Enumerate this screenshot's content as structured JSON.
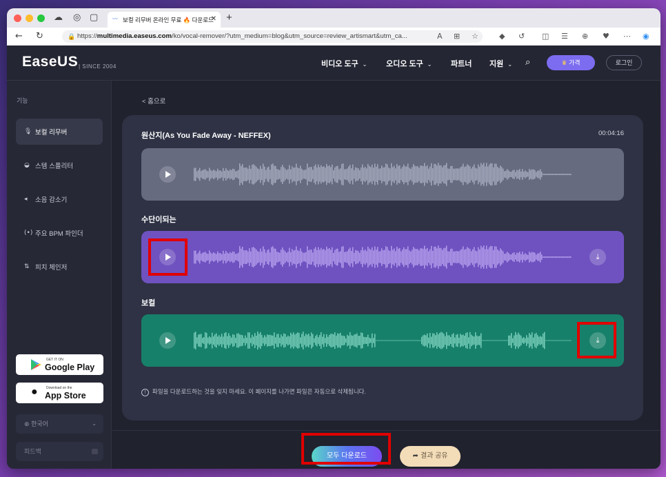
{
  "browser": {
    "tab_title": "보컬 리무버 온라인 무료 🔥 다운로드",
    "url_prefix": "https://",
    "url_domain": "multimedia.easeus.com",
    "url_path": "/ko/vocal-remover/?utm_medium=blog&utm_source=review_artismart&utm_ca..."
  },
  "header": {
    "logo": "EaseUS",
    "since": "| SINCE 2004",
    "nav": [
      {
        "label": "비디오 도구"
      },
      {
        "label": "오디오 도구"
      },
      {
        "label": "파트너"
      },
      {
        "label": "지원"
      }
    ],
    "price_label": "가격",
    "login_label": "로그인"
  },
  "sidebar": {
    "heading": "기능",
    "items": [
      {
        "label": "보컬 리무버",
        "icon": "microphone-icon",
        "active": true
      },
      {
        "label": "스템 스플리터",
        "icon": "stem-icon",
        "active": false
      },
      {
        "label": "소음 감소기",
        "icon": "noise-icon",
        "active": false
      },
      {
        "label": "주요 BPM 파인더",
        "icon": "bpm-icon",
        "active": false
      },
      {
        "label": "피치 체인저",
        "icon": "pitch-icon",
        "active": false
      }
    ],
    "google_play": {
      "small": "GET IT ON",
      "big": "Google Play"
    },
    "app_store": {
      "small": "Download on the",
      "big": "App Store"
    },
    "language": "한국어",
    "feedback": "피드백"
  },
  "main": {
    "back_link": "< 홈으로",
    "original_title": "원산지(As You Fade Away - NEFFEX)",
    "duration": "00:04:16",
    "instrumental_title": "수단이되는",
    "vocal_title": "보컬",
    "notice": "파일을 다운로드하는 것을 잊지 마세요. 이 페이지를 나가면 파일은 자동으로 삭제됩니다.",
    "download_all_label": "모두 다운로드",
    "share_label": "결과 공유"
  },
  "colors": {
    "accent_purple": "#7b6cf0",
    "instrumental_track": "#6f52c0",
    "vocal_track": "#17806a",
    "original_track": "#666b80",
    "highlight_red": "#e00000"
  }
}
